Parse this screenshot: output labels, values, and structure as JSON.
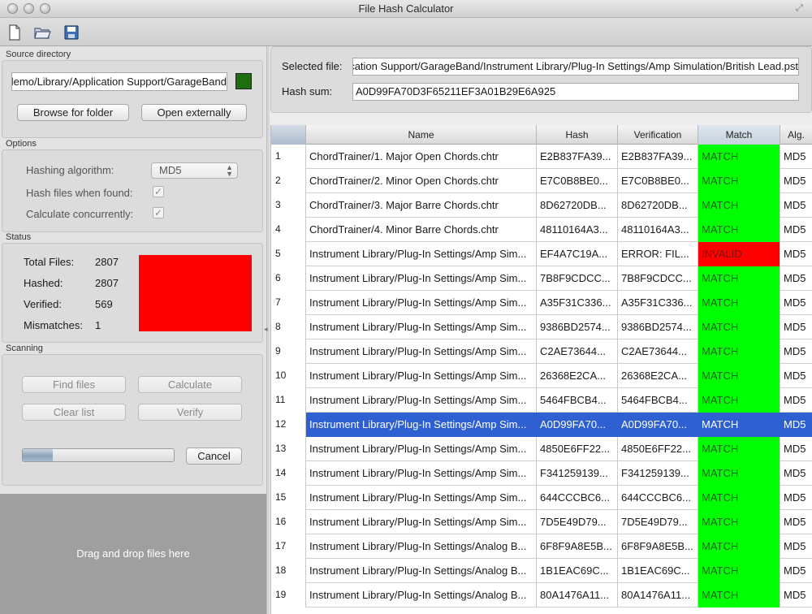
{
  "window": {
    "title": "File Hash Calculator"
  },
  "toolbar": {
    "icons": [
      "new-document-icon",
      "open-folder-icon",
      "save-disk-icon"
    ]
  },
  "source_directory": {
    "group_label": "Source directory",
    "path": "/Users/demo/Library/Application Support/GarageBand",
    "color": "#1f6e0d",
    "browse_button": "Browse for folder",
    "open_button": "Open externally"
  },
  "options": {
    "group_label": "Options",
    "algorithm_label": "Hashing algorithm:",
    "algorithm_value": "MD5",
    "hash_when_found_label": "Hash files when found:",
    "hash_when_found_checked": true,
    "concurrent_label": "Calculate concurrently:",
    "concurrent_checked": true
  },
  "status": {
    "group_label": "Status",
    "total_label": "Total Files:",
    "total_value": "2807",
    "hashed_label": "Hashed:",
    "hashed_value": "2807",
    "verified_label": "Verified:",
    "verified_value": "569",
    "mismatches_label": "Mismatches:",
    "mismatches_value": "1",
    "indicator_color": "#ff0000"
  },
  "scanning": {
    "group_label": "Scanning",
    "find_button": "Find files",
    "calculate_button": "Calculate",
    "clear_button": "Clear list",
    "verify_button": "Verify",
    "progress": 0.2,
    "cancel_button": "Cancel"
  },
  "drop_zone": {
    "text": "Drag and drop files here"
  },
  "selection": {
    "file_label": "Selected file:",
    "file_value": "Application Support/GarageBand/Instrument Library/Plug-In Settings/Amp Simulation/British Lead.pst",
    "hash_label": "Hash sum:",
    "hash_value": "A0D99FA70D3F65211EF3A01B29E6A925"
  },
  "table": {
    "columns": [
      "Name",
      "Hash",
      "Verification",
      "Match",
      "Alg."
    ],
    "match_color": "#00ff00",
    "invalid_color": "#ff0000",
    "selected_row": 12,
    "rows": [
      {
        "num": "1",
        "name": "ChordTrainer/1. Major Open Chords.chtr",
        "hash": "E2B837FA39...",
        "verification": "E2B837FA39...",
        "match": "MATCH",
        "alg": "MD5"
      },
      {
        "num": "2",
        "name": "ChordTrainer/2. Minor Open Chords.chtr",
        "hash": "E7C0B8BE0...",
        "verification": "E7C0B8BE0...",
        "match": "MATCH",
        "alg": "MD5"
      },
      {
        "num": "3",
        "name": "ChordTrainer/3. Major Barre Chords.chtr",
        "hash": "8D62720DB...",
        "verification": "8D62720DB...",
        "match": "MATCH",
        "alg": "MD5"
      },
      {
        "num": "4",
        "name": "ChordTrainer/4. Minor Barre Chords.chtr",
        "hash": "48110164A3...",
        "verification": "48110164A3...",
        "match": "MATCH",
        "alg": "MD5"
      },
      {
        "num": "5",
        "name": "Instrument Library/Plug-In Settings/Amp Sim...",
        "hash": "EF4A7C19A...",
        "verification": "ERROR: FIL...",
        "match": "INVALID",
        "alg": "MD5"
      },
      {
        "num": "6",
        "name": "Instrument Library/Plug-In Settings/Amp Sim...",
        "hash": "7B8F9CDCC...",
        "verification": "7B8F9CDCC...",
        "match": "MATCH",
        "alg": "MD5"
      },
      {
        "num": "7",
        "name": "Instrument Library/Plug-In Settings/Amp Sim...",
        "hash": "A35F31C336...",
        "verification": "A35F31C336...",
        "match": "MATCH",
        "alg": "MD5"
      },
      {
        "num": "8",
        "name": "Instrument Library/Plug-In Settings/Amp Sim...",
        "hash": "9386BD2574...",
        "verification": "9386BD2574...",
        "match": "MATCH",
        "alg": "MD5"
      },
      {
        "num": "9",
        "name": "Instrument Library/Plug-In Settings/Amp Sim...",
        "hash": "C2AE73644...",
        "verification": "C2AE73644...",
        "match": "MATCH",
        "alg": "MD5"
      },
      {
        "num": "10",
        "name": "Instrument Library/Plug-In Settings/Amp Sim...",
        "hash": "26368E2CA...",
        "verification": "26368E2CA...",
        "match": "MATCH",
        "alg": "MD5"
      },
      {
        "num": "11",
        "name": "Instrument Library/Plug-In Settings/Amp Sim...",
        "hash": "5464FBCB4...",
        "verification": "5464FBCB4...",
        "match": "MATCH",
        "alg": "MD5"
      },
      {
        "num": "12",
        "name": "Instrument Library/Plug-In Settings/Amp Sim...",
        "hash": "A0D99FA70...",
        "verification": "A0D99FA70...",
        "match": "MATCH",
        "alg": "MD5"
      },
      {
        "num": "13",
        "name": "Instrument Library/Plug-In Settings/Amp Sim...",
        "hash": "4850E6FF22...",
        "verification": "4850E6FF22...",
        "match": "MATCH",
        "alg": "MD5"
      },
      {
        "num": "14",
        "name": "Instrument Library/Plug-In Settings/Amp Sim...",
        "hash": "F341259139...",
        "verification": "F341259139...",
        "match": "MATCH",
        "alg": "MD5"
      },
      {
        "num": "15",
        "name": "Instrument Library/Plug-In Settings/Amp Sim...",
        "hash": "644CCCBC6...",
        "verification": "644CCCBC6...",
        "match": "MATCH",
        "alg": "MD5"
      },
      {
        "num": "16",
        "name": "Instrument Library/Plug-In Settings/Amp Sim...",
        "hash": "7D5E49D79...",
        "verification": "7D5E49D79...",
        "match": "MATCH",
        "alg": "MD5"
      },
      {
        "num": "17",
        "name": "Instrument Library/Plug-In Settings/Analog B...",
        "hash": "6F8F9A8E5B...",
        "verification": "6F8F9A8E5B...",
        "match": "MATCH",
        "alg": "MD5"
      },
      {
        "num": "18",
        "name": "Instrument Library/Plug-In Settings/Analog B...",
        "hash": "1B1EAC69C...",
        "verification": "1B1EAC69C...",
        "match": "MATCH",
        "alg": "MD5"
      },
      {
        "num": "19",
        "name": "Instrument Library/Plug-In Settings/Analog B...",
        "hash": "80A1476A11...",
        "verification": "80A1476A11...",
        "match": "MATCH",
        "alg": "MD5"
      }
    ]
  }
}
